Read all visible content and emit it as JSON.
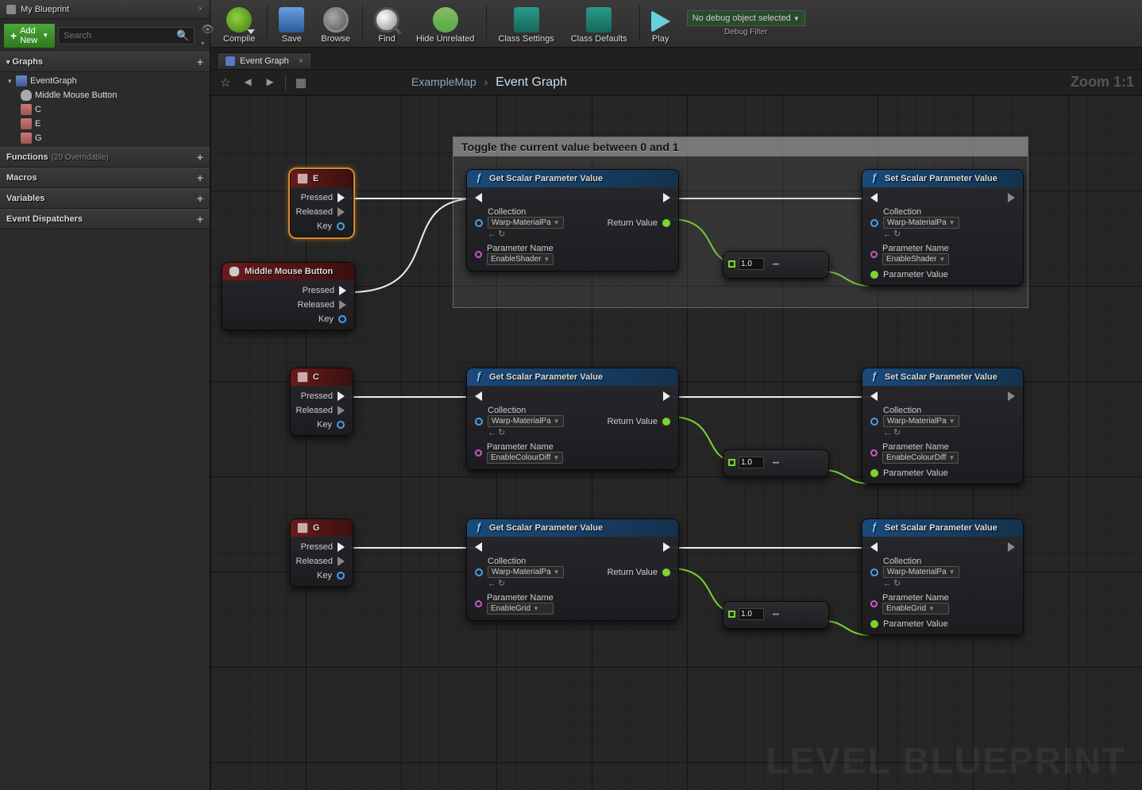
{
  "toolbar": {
    "compile": "Compile",
    "save": "Save",
    "browse": "Browse",
    "find": "Find",
    "hide": "Hide Unrelated",
    "classSettings": "Class Settings",
    "classDefaults": "Class Defaults",
    "play": "Play",
    "debugSelect": "No debug object selected",
    "debugLabel": "Debug Filter"
  },
  "leftPanel": {
    "tab": "My Blueprint",
    "addNew": "Add New",
    "searchPlaceholder": "Search",
    "cats": {
      "graphs": "Graphs",
      "functions": "Functions",
      "functionsSub": "(20 Overridable)",
      "macros": "Macros",
      "variables": "Variables",
      "dispatchers": "Event Dispatchers"
    },
    "tree": {
      "eventGraph": "EventGraph",
      "mmb": "Middle Mouse Button",
      "c": "C",
      "e": "E",
      "g": "G"
    }
  },
  "graphTab": "Event Graph",
  "breadcrumb": {
    "root": "ExampleMap",
    "cur": "Event Graph"
  },
  "zoom": "Zoom 1:1",
  "watermark": "LEVEL BLUEPRINT",
  "comment": "Toggle the current value between 0 and 1",
  "nodes": {
    "key": {
      "pressed": "Pressed",
      "released": "Released",
      "keyPin": "Key"
    },
    "mmb": "Middle Mouse Button",
    "e": "E",
    "c": "C",
    "g": "G",
    "get": "Get Scalar Parameter Value",
    "set": "Set Scalar Parameter Value",
    "collection": "Collection",
    "collVal": "Warp-MaterialPa",
    "paramName": "Parameter Name",
    "paramValue": "Parameter Value",
    "returnValue": "Return Value",
    "params": {
      "shader": "EnableShader",
      "colour": "EnableColourDiff",
      "grid": "EnableGrid"
    },
    "mathVal": "1.0"
  }
}
